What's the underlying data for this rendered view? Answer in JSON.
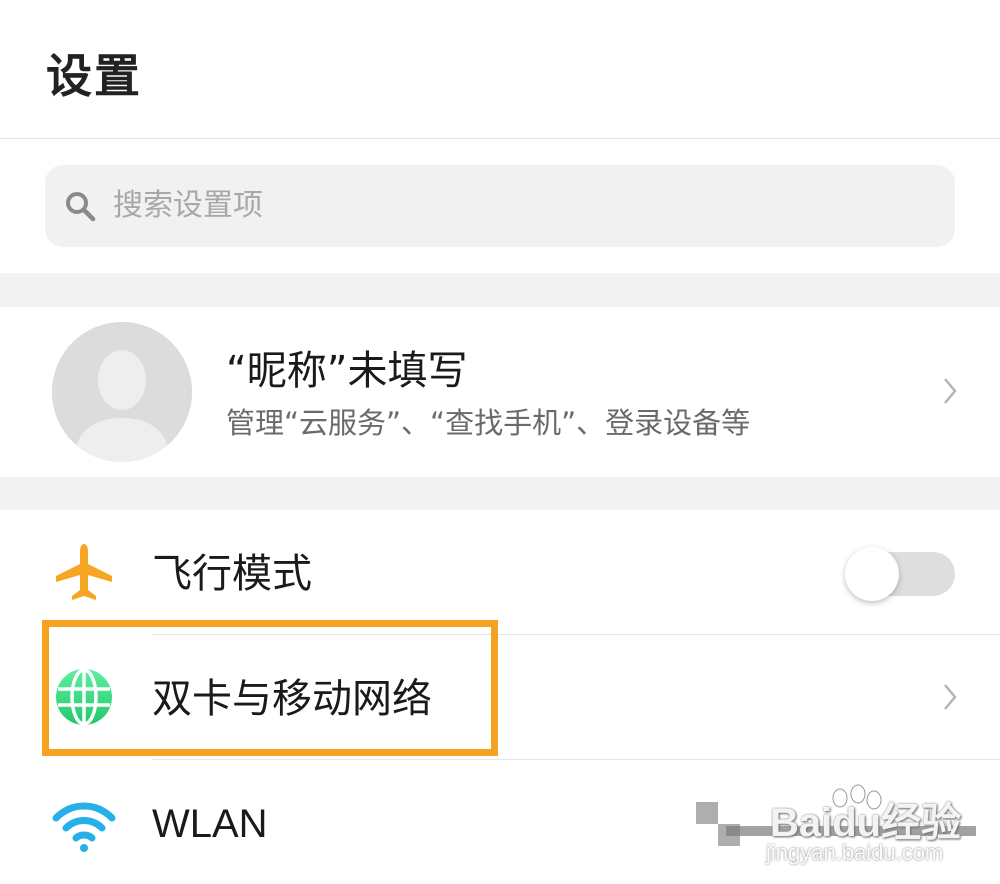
{
  "header": {
    "title": "设置"
  },
  "search": {
    "placeholder": "搜索设置项",
    "icon": "search-icon"
  },
  "account": {
    "name": "“昵称”未填写",
    "description": "管理“云服务”、“查找手机”、登录设备等",
    "icon": "avatar-placeholder-icon"
  },
  "settings": {
    "items": [
      {
        "label": "飞行模式",
        "icon": "airplane-icon",
        "icon_color": "#f7a623",
        "toggle_on": false
      },
      {
        "label": "双卡与移动网络",
        "icon": "globe-icon",
        "icon_color": "#3ddc84"
      },
      {
        "label": "WLAN",
        "icon": "wifi-icon",
        "icon_color": "#27b0e8"
      }
    ]
  },
  "highlight": {
    "color": "#f5a220"
  },
  "watermark": {
    "text": "Baidu经验",
    "url": "jingyan.baidu.com"
  }
}
